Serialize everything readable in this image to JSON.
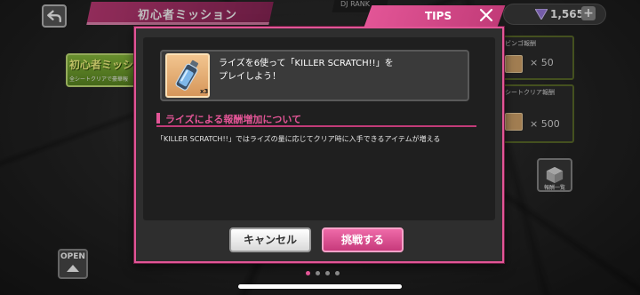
{
  "header": {
    "mission_title": "初心者ミッション",
    "dj_rank_label": "DJ RANK",
    "currency_value": "1,565"
  },
  "background": {
    "beginner_banner_title": "初心者ミッシ",
    "beginner_banner_sub": "全シートクリアで豪華報",
    "reward_cards": [
      {
        "label": "ビンゴ報酬",
        "value": "× 50"
      },
      {
        "label": "シートクリア報酬",
        "value": "× 500"
      }
    ],
    "reward_list_label": "報酬一覧",
    "open_label": "OPEN"
  },
  "modal": {
    "tab_title": "TIPS",
    "item_count": "x3",
    "mission_text_line1": "ライズを6使って「KILLER SCRATCH!!」を",
    "mission_text_line2": "プレイしよう！",
    "section_heading": "ライズによる報酬増加について",
    "section_body": "「KILLER SCRATCH!!」ではライズの量に応じてクリア時に入手できるアイテムが増える",
    "cancel_label": "キャンセル",
    "challenge_label": "挑戦する"
  },
  "pager": {
    "total": 4,
    "active_index": 0
  },
  "colors": {
    "accent": "#e25596",
    "accent_dark": "#c23b78",
    "modal_bg": "#2e2e2e"
  },
  "icons": [
    "back-arrow-icon",
    "close-icon",
    "gem-icon",
    "plus-icon",
    "bottle-icon",
    "box-icon",
    "up-arrow-icon"
  ]
}
